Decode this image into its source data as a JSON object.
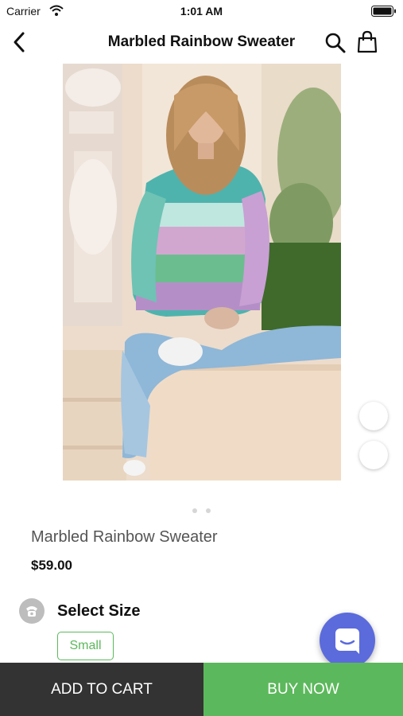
{
  "status_bar": {
    "carrier": "Carrier",
    "time": "1:01 AM"
  },
  "nav": {
    "title": "Marbled Rainbow Sweater",
    "back_icon": "chevron-left-icon",
    "search_icon": "search-icon",
    "bag_icon": "shopping-bag-icon"
  },
  "gallery": {
    "page_count": 2,
    "current_page": 1
  },
  "product": {
    "name": "Marbled Rainbow Sweater",
    "price": "$59.00"
  },
  "size": {
    "label": "Select Size",
    "selected": "Small"
  },
  "actions": {
    "add_to_cart": "ADD TO CART",
    "buy_now": "BUY NOW"
  },
  "colors": {
    "accent_green": "#5cb85c",
    "dark_button": "#333333",
    "chat_button": "#5b6bdc"
  }
}
